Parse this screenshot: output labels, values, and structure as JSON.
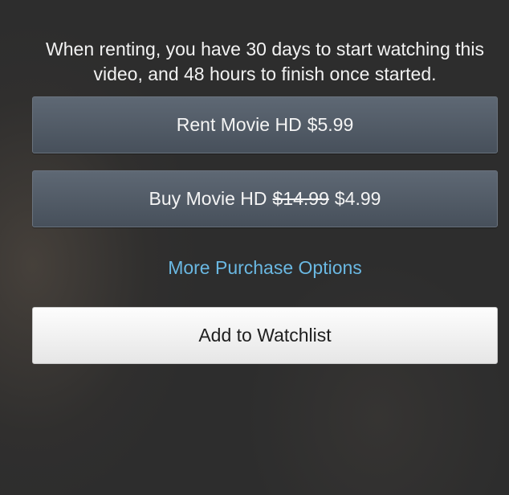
{
  "rental_notice": "When renting, you have 30 days to start watching this video, and 48 hours to finish once started.",
  "rent_button": {
    "label": "Rent Movie HD",
    "price": "$5.99"
  },
  "buy_button": {
    "label": "Buy Movie HD",
    "original_price": "$14.99",
    "sale_price": "$4.99"
  },
  "more_options_link": "More Purchase Options",
  "watchlist_button": "Add to Watchlist",
  "colors": {
    "background": "#2d2d2d",
    "dark_button": "#535c67",
    "link": "#6ab8e2",
    "light_button": "#f2f2f2"
  }
}
